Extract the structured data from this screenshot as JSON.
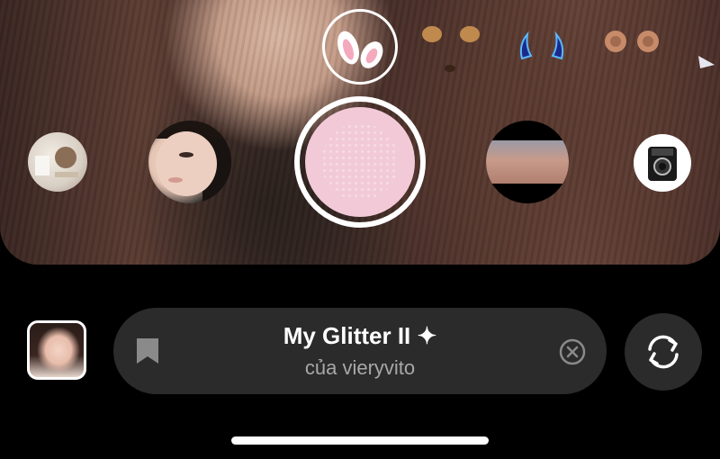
{
  "effect_bar": {
    "title": "My Glitter II ✦",
    "author": "của vieryvito"
  },
  "icons": {
    "save": "bookmark-icon",
    "clear": "clear-circle-x-icon",
    "flip": "flip-camera-icon"
  },
  "colors": {
    "selected_effect": "#f2cad7",
    "pill_background": "#2b2b2b"
  }
}
